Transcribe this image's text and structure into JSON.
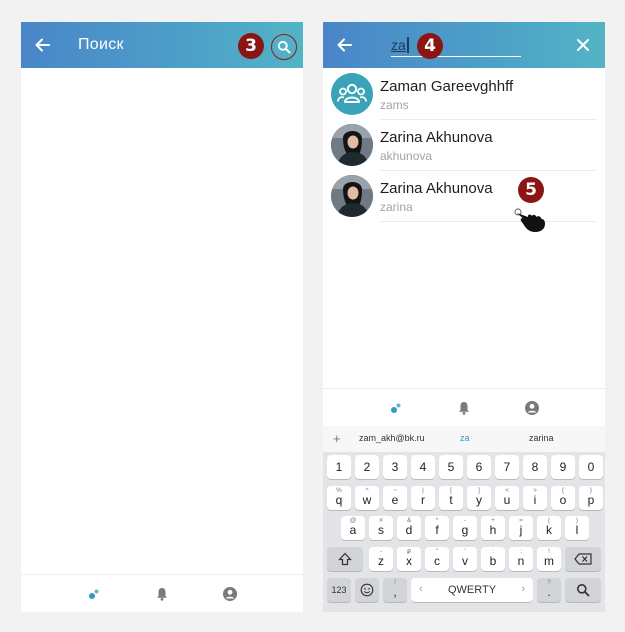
{
  "left_screen": {
    "title": "Поиск",
    "step_badge": "3"
  },
  "right_screen": {
    "search_query": "za",
    "step_badge_query": "4",
    "step_badge_result": "5",
    "results": [
      {
        "name": "Zaman Gareevghhff",
        "username": "zams",
        "avatar": "group-icon"
      },
      {
        "name": "Zarina Akhunova",
        "username": "akhunova",
        "avatar": "profile-photo"
      },
      {
        "name": "Zarina Akhunova",
        "username": "zarina",
        "avatar": "profile-photo"
      }
    ],
    "suggestions": [
      "zam_akh@bk.ru",
      "za",
      "zarina"
    ],
    "keyboard": {
      "number_row": [
        "1",
        "2",
        "3",
        "4",
        "5",
        "6",
        "7",
        "8",
        "9",
        "0"
      ],
      "row1": [
        {
          "k": "q",
          "a": "%"
        },
        {
          "k": "w",
          "a": "^"
        },
        {
          "k": "e",
          "a": "~"
        },
        {
          "k": "r",
          "a": "|"
        },
        {
          "k": "t",
          "a": "["
        },
        {
          "k": "y",
          "a": "]"
        },
        {
          "k": "u",
          "a": "<"
        },
        {
          "k": "i",
          "a": ">"
        },
        {
          "k": "o",
          "a": "{"
        },
        {
          "k": "p",
          "a": "}"
        }
      ],
      "row2": [
        {
          "k": "a",
          "a": "@"
        },
        {
          "k": "s",
          "a": "#"
        },
        {
          "k": "d",
          "a": "&"
        },
        {
          "k": "f",
          "a": "*"
        },
        {
          "k": "g",
          "a": "-"
        },
        {
          "k": "h",
          "a": "+"
        },
        {
          "k": "j",
          "a": "="
        },
        {
          "k": "k",
          "a": "("
        },
        {
          "k": "l",
          "a": ")"
        }
      ],
      "row3": [
        {
          "k": "z",
          "a": "-"
        },
        {
          "k": "x",
          "a": "₽"
        },
        {
          "k": "c",
          "a": "\""
        },
        {
          "k": "v",
          "a": "'"
        },
        {
          "k": "b",
          "a": ":"
        },
        {
          "k": "n",
          "a": ";"
        },
        {
          "k": "m",
          "a": "!"
        }
      ],
      "symbols_label": "123",
      "space_label": "QWERTY",
      "comma": ",",
      "comma_alt": "!",
      "period": ".",
      "period_alt": "?",
      "space_left": "‹",
      "space_right": "›"
    }
  },
  "colors": {
    "appbar_start": "#4a86c9",
    "appbar_end": "#52b4c5",
    "badge": "#8b1515",
    "accent": "#3aa3c2"
  }
}
